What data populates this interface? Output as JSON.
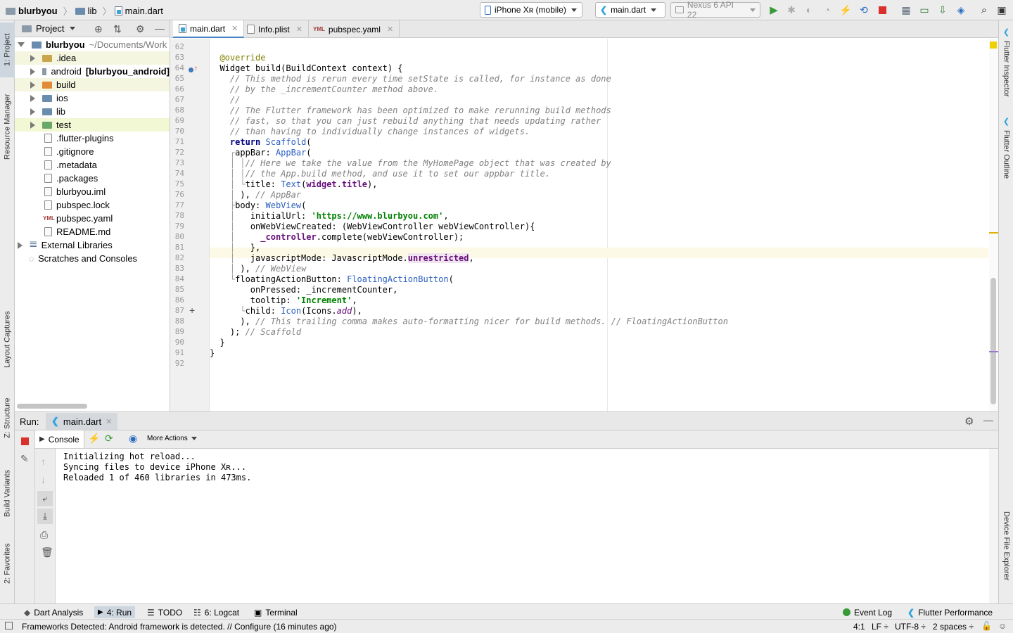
{
  "breadcrumb": {
    "project": "blurbyou",
    "folder": "lib",
    "file": "main.dart"
  },
  "toolbar": {
    "device_selector": "iPhone Xʀ (mobile)",
    "run_config": "main.dart",
    "emulator": "Nexus 6 API 22"
  },
  "left_stripe": {
    "project": "1: Project",
    "resource_manager": "Resource Manager",
    "layout_captures": "Layout Captures",
    "structure": "Z: Structure",
    "build_variants": "Build Variants",
    "favorites": "2: Favorites"
  },
  "right_stripe": {
    "flutter_inspector": "Flutter Inspector",
    "flutter_outline": "Flutter Outline",
    "device_file_explorer": "Device File Explorer"
  },
  "project_pane": {
    "title": "Project",
    "root_name": "blurbyou",
    "root_path": "~/Documents/Work",
    "items": [
      {
        "label": ".idea"
      },
      {
        "label": "android",
        "suffix": "[blurbyou_android]"
      },
      {
        "label": "build"
      },
      {
        "label": "ios"
      },
      {
        "label": "lib"
      },
      {
        "label": "test"
      },
      {
        "label": ".flutter-plugins"
      },
      {
        "label": ".gitignore"
      },
      {
        "label": ".metadata"
      },
      {
        "label": ".packages"
      },
      {
        "label": "blurbyou.iml"
      },
      {
        "label": "pubspec.lock"
      },
      {
        "label": "pubspec.yaml"
      },
      {
        "label": "README.md"
      },
      {
        "label": "External Libraries"
      },
      {
        "label": "Scratches and Consoles"
      }
    ]
  },
  "editor_tabs": [
    {
      "label": "main.dart"
    },
    {
      "label": "Info.plist"
    },
    {
      "label": "pubspec.yaml"
    }
  ],
  "code": {
    "line_numbers": [
      "62",
      "63",
      "64",
      "65",
      "66",
      "67",
      "68",
      "69",
      "70",
      "71",
      "72",
      "73",
      "74",
      "75",
      "76",
      "77",
      "78",
      "79",
      "80",
      "81",
      "82",
      "83",
      "84",
      "85",
      "86",
      "87",
      "88",
      "89",
      "90",
      "91",
      "92"
    ],
    "lines": [
      "",
      "  @override",
      "  Widget build(BuildContext context) {",
      "    // This method is rerun every time setState is called, for instance as done",
      "    // by the _incrementCounter method above.",
      "    //",
      "    // The Flutter framework has been optimized to make rerunning build methods",
      "    // fast, so that you can just rebuild anything that needs updating rather",
      "    // than having to individually change instances of widgets.",
      "    return Scaffold(",
      "      appBar: AppBar(",
      "        // Here we take the value from the MyHomePage object that was created by",
      "        // the App.build method, and use it to set our appbar title.",
      "        title: Text(widget.title),",
      "      ), // AppBar",
      "      body: WebView(",
      "        initialUrl: 'https://www.blurbyou.com',",
      "        onWebViewCreated: (WebViewController webViewController){",
      "          _controller.complete(webViewController);",
      "        },",
      "        javascriptMode: JavascriptMode.unrestricted,",
      "      ), // WebView",
      "      floatingActionButton: FloatingActionButton(",
      "        onPressed: _incrementCounter,",
      "        tooltip: 'Increment',",
      "        child: Icon(Icons.add),",
      "      ), // This trailing comma makes auto-formatting nicer for build methods. // FloatingActionButton",
      "    ); // Scaffold",
      "  }",
      "}",
      ""
    ]
  },
  "run_pane": {
    "label": "Run:",
    "tab": "main.dart",
    "console_tab": "Console",
    "more_actions": "More Actions",
    "console_lines": [
      "Initializing hot reload...",
      "Syncing files to device iPhone Xʀ...",
      "Reloaded 1 of 460 libraries in 473ms."
    ]
  },
  "bottom_tools": {
    "dart_analysis": "Dart Analysis",
    "run": "4: Run",
    "todo": "TODO",
    "logcat": "6: Logcat",
    "terminal": "Terminal",
    "event_log": "Event Log",
    "flutter_performance": "Flutter Performance"
  },
  "status": {
    "message": "Frameworks Detected: Android framework is detected. // Configure (16 minutes ago)",
    "position": "4:1",
    "line_sep": "LF ÷",
    "encoding": "UTF-8 ÷",
    "indent": "2 spaces ÷"
  },
  "colors": {
    "accent": "#4a83c4",
    "run_green": "#3a9a3a",
    "stop_red": "#d9302c",
    "current_line": "#fcfae6"
  }
}
